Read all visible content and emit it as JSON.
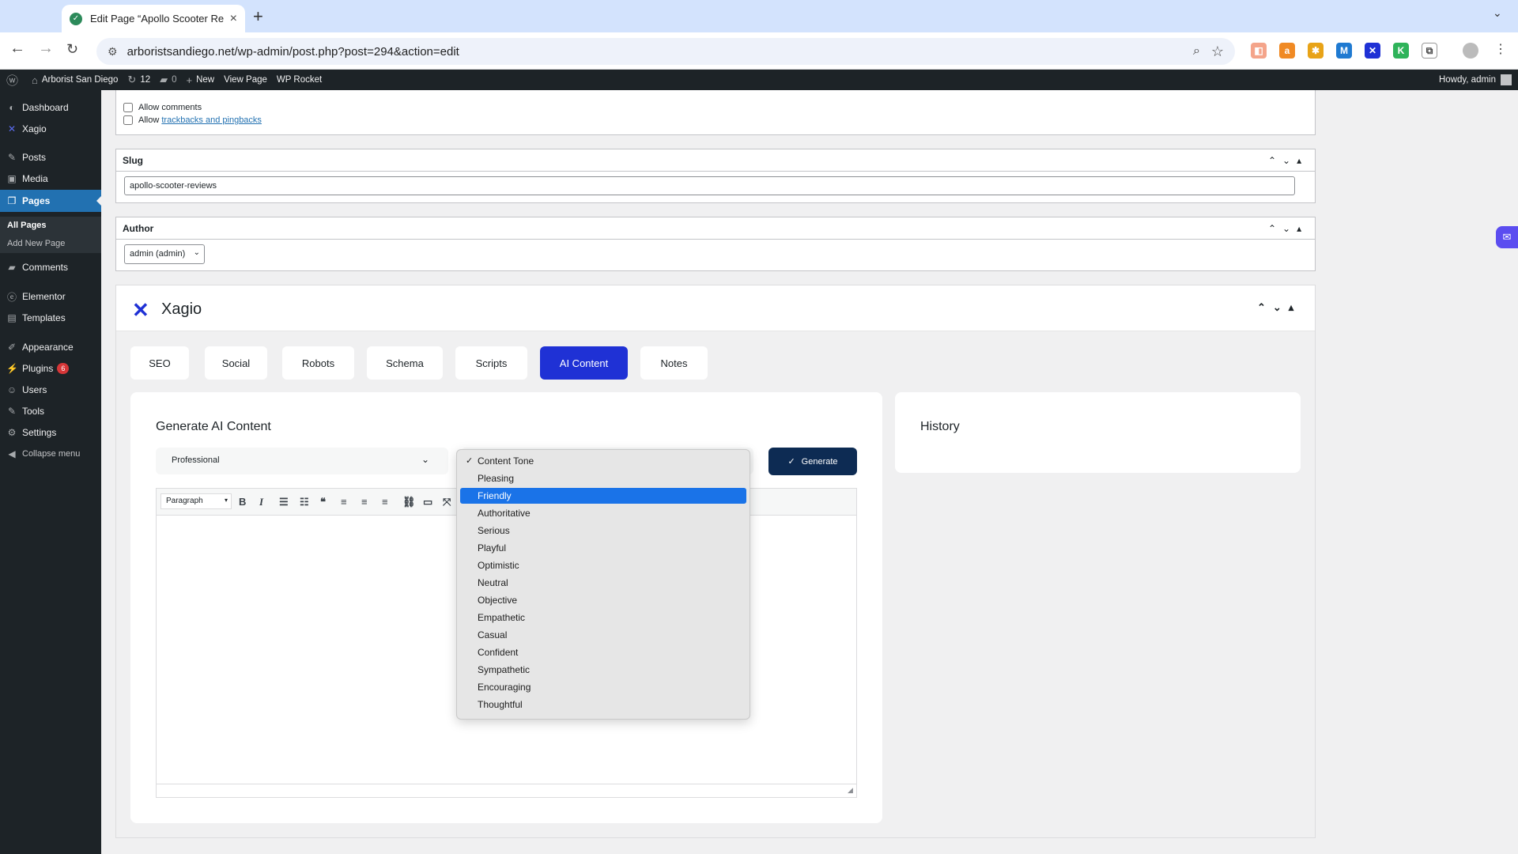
{
  "browser": {
    "tab_title": "Edit Page “Apollo Scooter Re",
    "url": "arboristsandiego.net/wp-admin/post.php?post=294&action=edit"
  },
  "adminbar": {
    "site_name": "Arborist San Diego",
    "updates": "12",
    "comments": "0",
    "new_label": "New",
    "view_page": "View Page",
    "wp_rocket": "WP Rocket",
    "howdy": "Howdy, admin"
  },
  "sidebar": {
    "items": [
      {
        "label": "Dashboard",
        "icon": "dashboard-icon"
      },
      {
        "label": "Xagio",
        "icon": "xagio-icon"
      },
      {
        "label": "Posts",
        "icon": "pin-icon"
      },
      {
        "label": "Media",
        "icon": "media-icon"
      },
      {
        "label": "Pages",
        "icon": "pages-icon"
      },
      {
        "label": "Comments",
        "icon": "comment-icon"
      },
      {
        "label": "Elementor",
        "icon": "elementor-icon"
      },
      {
        "label": "Templates",
        "icon": "folder-icon"
      },
      {
        "label": "Appearance",
        "icon": "brush-icon"
      },
      {
        "label": "Plugins",
        "icon": "plug-icon",
        "badge": "6"
      },
      {
        "label": "Users",
        "icon": "user-icon"
      },
      {
        "label": "Tools",
        "icon": "wrench-icon"
      },
      {
        "label": "Settings",
        "icon": "settings-icon"
      },
      {
        "label": "Collapse menu",
        "icon": "collapse-icon"
      }
    ],
    "submenu": [
      "All Pages",
      "Add New Page"
    ]
  },
  "discussion": {
    "allow_comments": "Allow comments",
    "allow_prefix": "Allow",
    "trackbacks_link": "trackbacks and pingbacks"
  },
  "slug": {
    "title": "Slug",
    "value": "apollo-scooter-reviews"
  },
  "author": {
    "title": "Author",
    "value": "admin (admin)"
  },
  "xagio": {
    "brand": "Xagio",
    "tabs": [
      "SEO",
      "Social",
      "Robots",
      "Schema",
      "Scripts",
      "AI Content",
      "Notes"
    ],
    "active_tab": "AI Content",
    "generate_title": "Generate AI Content",
    "tone_select_value": "Professional",
    "generate_button": "Generate",
    "editor_format": "Paragraph",
    "history_title": "History"
  },
  "tone_dropdown": {
    "options": [
      "Content Tone",
      "Pleasing",
      "Friendly",
      "Authoritative",
      "Serious",
      "Playful",
      "Optimistic",
      "Neutral",
      "Objective",
      "Empathetic",
      "Casual",
      "Confident",
      "Sympathetic",
      "Encouraging",
      "Thoughtful"
    ],
    "checked": "Content Tone",
    "highlighted": "Friendly"
  },
  "colors": {
    "wp_dark": "#1d2327",
    "wp_blue": "#2271b1",
    "xagio_blue": "#1f31d5",
    "generate_navy": "#0d2b53",
    "highlight": "#1a73e8"
  }
}
